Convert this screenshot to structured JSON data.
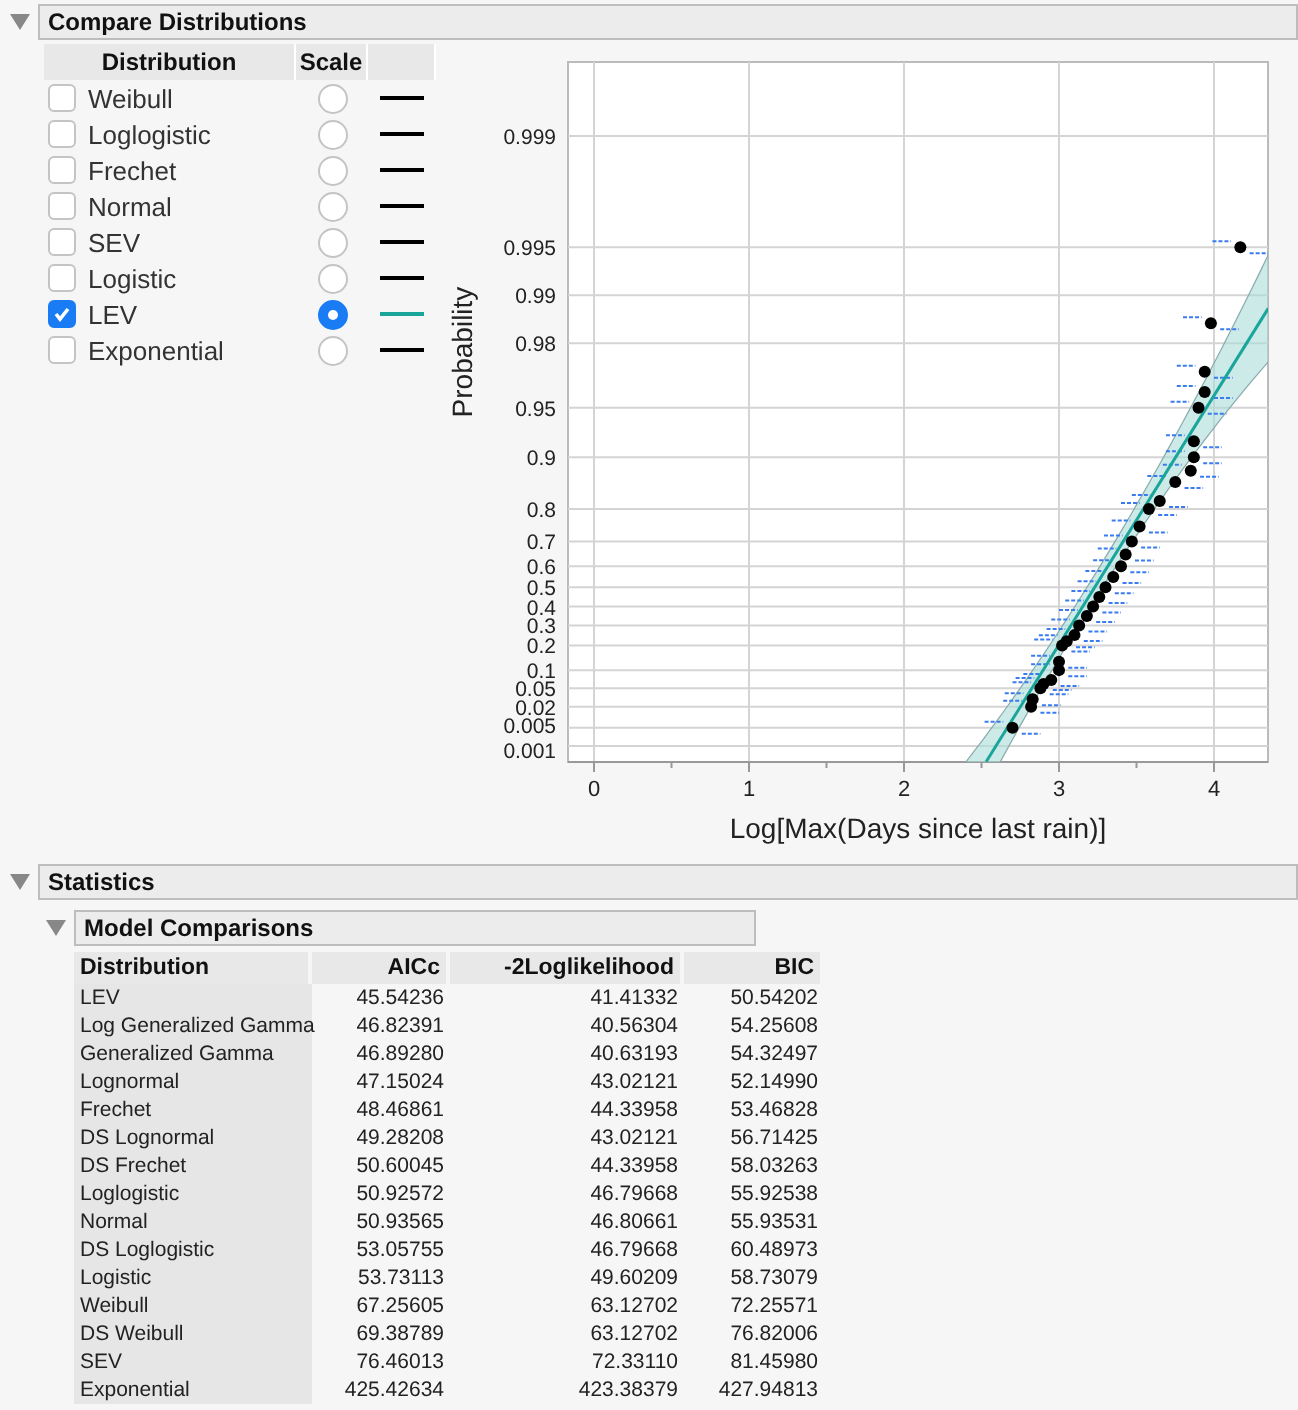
{
  "compare": {
    "title": "Compare Distributions",
    "expanded": true,
    "columns": [
      "Distribution",
      "Scale"
    ],
    "items": [
      {
        "name": "Weibull",
        "checked": false,
        "selected": false,
        "color": "#000000"
      },
      {
        "name": "Loglogistic",
        "checked": false,
        "selected": false,
        "color": "#000000"
      },
      {
        "name": "Frechet",
        "checked": false,
        "selected": false,
        "color": "#000000"
      },
      {
        "name": "Normal",
        "checked": false,
        "selected": false,
        "color": "#000000"
      },
      {
        "name": "SEV",
        "checked": false,
        "selected": false,
        "color": "#000000"
      },
      {
        "name": "Logistic",
        "checked": false,
        "selected": false,
        "color": "#000000"
      },
      {
        "name": "LEV",
        "checked": true,
        "selected": true,
        "color": "#1aa59a"
      },
      {
        "name": "Exponential",
        "checked": false,
        "selected": false,
        "color": "#000000"
      }
    ],
    "probability_plot": {
      "xlabel": "Log[Max(Days since last rain)]",
      "ylabel": "Probability",
      "x_tick_labels": [
        "0",
        "1",
        "2",
        "3",
        "4"
      ],
      "y_tick_labels": [
        "0.999",
        "0.995",
        "0.99",
        "0.98",
        "0.95",
        "0.9",
        "0.8",
        "0.7",
        "0.6",
        "0.5",
        "0.4",
        "0.3",
        "0.2",
        "0.1",
        "0.05",
        "0.02",
        "0.005",
        "0.001"
      ]
    }
  },
  "statistics": {
    "title": "Statistics",
    "expanded": true,
    "model_comparisons": {
      "title": "Model Comparisons",
      "expanded": true,
      "columns": [
        "Distribution",
        "AICc",
        "-2Loglikelihood",
        "BIC"
      ],
      "rows": [
        [
          "LEV",
          "45.54236",
          "41.41332",
          "50.54202"
        ],
        [
          "Log Generalized Gamma",
          "46.82391",
          "40.56304",
          "54.25608"
        ],
        [
          "Generalized Gamma",
          "46.89280",
          "40.63193",
          "54.32497"
        ],
        [
          "Lognormal",
          "47.15024",
          "43.02121",
          "52.14990"
        ],
        [
          "Frechet",
          "48.46861",
          "44.33958",
          "53.46828"
        ],
        [
          "DS Lognormal",
          "49.28208",
          "43.02121",
          "56.71425"
        ],
        [
          "DS Frechet",
          "50.60045",
          "44.33958",
          "58.03263"
        ],
        [
          "Loglogistic",
          "50.92572",
          "46.79668",
          "55.92538"
        ],
        [
          "Normal",
          "50.93565",
          "46.80661",
          "55.93531"
        ],
        [
          "DS Loglogistic",
          "53.05755",
          "46.79668",
          "60.48973"
        ],
        [
          "Logistic",
          "53.73113",
          "49.60209",
          "58.73079"
        ],
        [
          "Weibull",
          "67.25605",
          "63.12702",
          "72.25571"
        ],
        [
          "DS Weibull",
          "69.38789",
          "63.12702",
          "76.82006"
        ],
        [
          "SEV",
          "76.46013",
          "72.33110",
          "81.45980"
        ],
        [
          "Exponential",
          "425.42634",
          "423.38379",
          "427.94813"
        ]
      ]
    }
  }
}
